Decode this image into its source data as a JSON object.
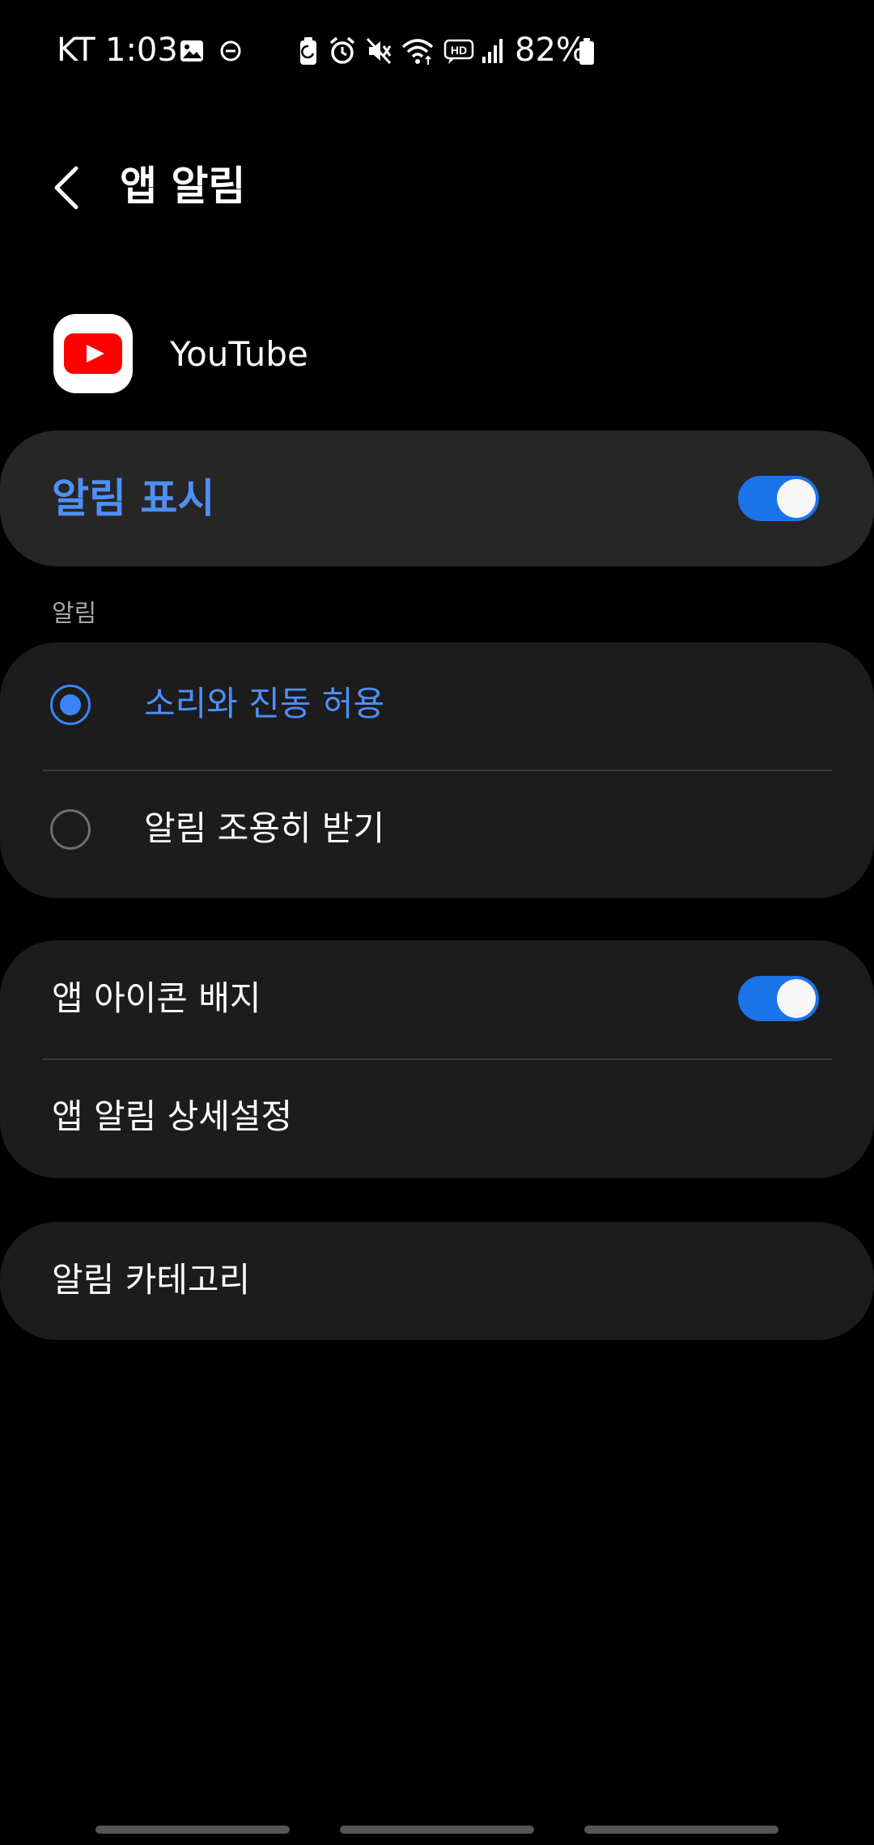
{
  "status_bar": {
    "carrier": "KT",
    "time": "1:03",
    "battery": "82%",
    "icons": [
      "gallery-icon",
      "dnd-icon",
      "battery-saver-icon",
      "alarm-icon",
      "mute-icon",
      "wifi-icon",
      "hd-voice-icon",
      "signal-icon",
      "battery-icon"
    ]
  },
  "header": {
    "title": "앱 알림"
  },
  "app": {
    "name": "YouTube",
    "icon": "youtube-icon",
    "brand_color": "#ff0000"
  },
  "show_notifications": {
    "label": "알림 표시",
    "enabled": true
  },
  "alerts": {
    "section_label": "알림",
    "options": [
      {
        "label": "소리와 진동 허용",
        "selected": true
      },
      {
        "label": "알림 조용히 받기",
        "selected": false
      }
    ]
  },
  "settings": {
    "badge_label": "앱 아이콘 배지",
    "badge_enabled": true,
    "detail_label": "앱 알림 상세설정"
  },
  "categories": {
    "label": "알림 카테고리"
  },
  "colors": {
    "accent": "#3d83f5",
    "toggle_on": "#1a73e8",
    "card": "#1c1c1c"
  }
}
